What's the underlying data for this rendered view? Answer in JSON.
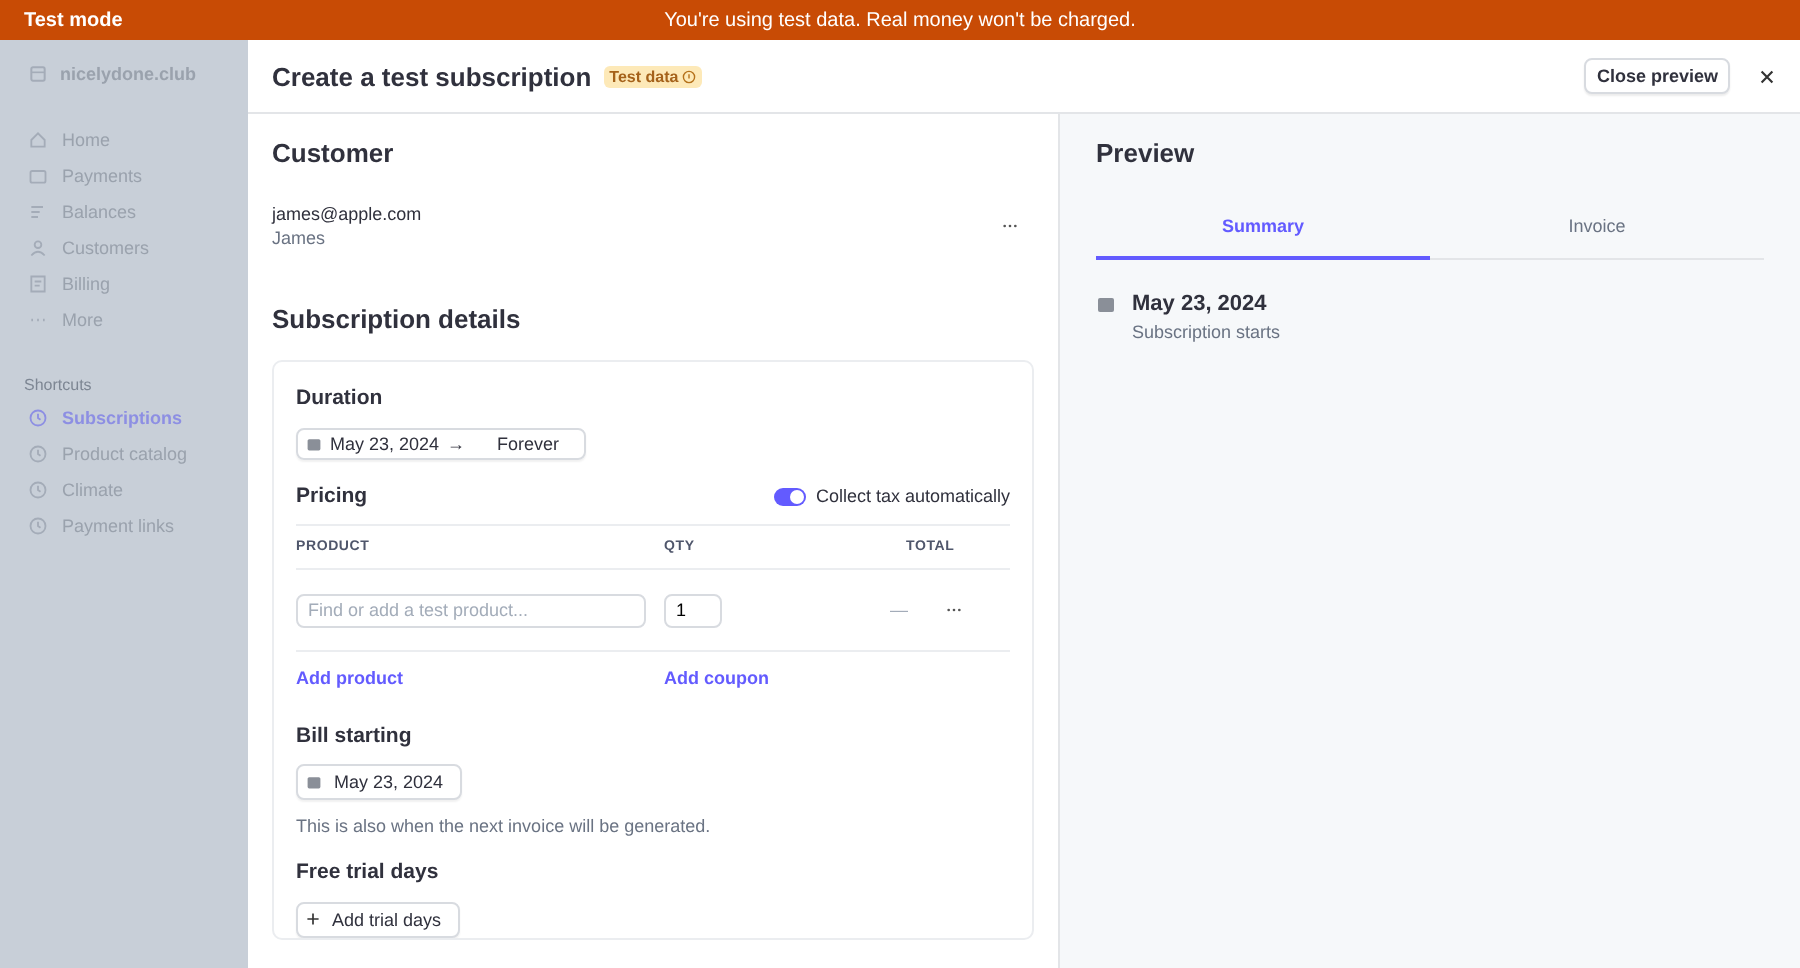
{
  "test_banner": {
    "label": "Test mode",
    "message": "You're using test data. Real money won't be charged."
  },
  "sidebar": {
    "account": "nicelydone.club",
    "items": [
      {
        "label": "Home",
        "selected": false
      },
      {
        "label": "Payments",
        "selected": false
      },
      {
        "label": "Balances",
        "selected": false
      },
      {
        "label": "Customers",
        "selected": false
      },
      {
        "label": "Billing",
        "selected": false
      },
      {
        "label": "More",
        "selected": false
      }
    ],
    "shortcuts_title": "Shortcuts",
    "shortcuts": [
      {
        "label": "Subscriptions",
        "selected": true
      },
      {
        "label": "Product catalog",
        "selected": false
      },
      {
        "label": "Climate",
        "selected": false
      },
      {
        "label": "Payment links",
        "selected": false
      }
    ]
  },
  "modal": {
    "title": "Create a test subscription",
    "badge": "Test data",
    "close_preview": "Close preview",
    "customer": {
      "heading": "Customer",
      "email": "james@apple.com",
      "name": "James"
    },
    "details": {
      "heading": "Subscription details",
      "duration_label": "Duration",
      "duration_start": "May 23, 2024",
      "duration_arrow": "→",
      "duration_end": "Forever",
      "pricing_label": "Pricing",
      "collect_tax": {
        "label": "Collect tax automatically",
        "on": true
      },
      "columns": [
        "PRODUCT",
        "QTY",
        "TOTAL"
      ],
      "row": {
        "product_placeholder": "Find or add a test product...",
        "qty": "1",
        "total": "—"
      },
      "add_product": "Add product",
      "add_coupon": "Add coupon",
      "bill_label": "Bill starting",
      "bill_date": "May 23, 2024",
      "bill_hint": "This is also when the next invoice will be generated.",
      "trial_label": "Free trial days",
      "trial_button": "Add trial days"
    }
  },
  "preview": {
    "heading": "Preview",
    "tabs": [
      {
        "label": "Summary",
        "selected": true
      },
      {
        "label": "Invoice",
        "selected": false
      }
    ],
    "date": "May 23, 2024",
    "caption": "Subscription starts"
  }
}
